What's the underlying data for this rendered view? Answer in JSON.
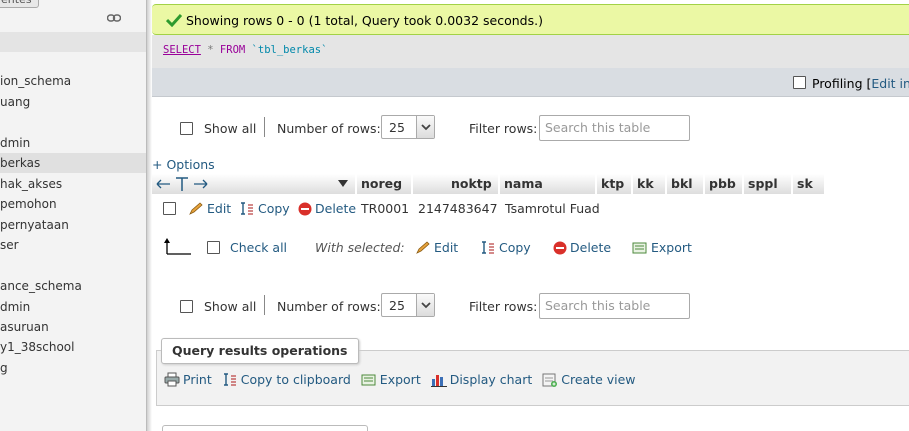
{
  "sidebar": {
    "top_tab": "entes",
    "databases": [
      {
        "label": "ion_schema"
      },
      {
        "label": "uang"
      },
      {
        "label": "dmin"
      },
      {
        "label": "berkas",
        "selected": true
      },
      {
        "label": "hak_akses"
      },
      {
        "label": "pemohon"
      },
      {
        "label": "pernyataan"
      },
      {
        "label": "ser"
      },
      {
        "label": "ance_schema"
      },
      {
        "label": "dmin"
      },
      {
        "label": "asuruan"
      },
      {
        "label": "y1_38school"
      },
      {
        "label": "g"
      }
    ]
  },
  "message": {
    "text": "Showing rows 0 - 0 (1 total, Query took 0.0032 seconds.)",
    "color": "#ebf8a4"
  },
  "sql": {
    "select": "SELECT",
    "star": "*",
    "from": "FROM",
    "table": "`tbl_berkas`"
  },
  "profiling": {
    "label": "Profiling [",
    "edit_inline": "Edit inli"
  },
  "nav": {
    "show_all": "Show all",
    "number_of_rows_label": "Number of rows:",
    "rows_value": "25",
    "filter_label": "Filter rows:",
    "filter_placeholder": "Search this table"
  },
  "options_link": "+ Options",
  "table": {
    "columns": [
      "noreg",
      "noktp",
      "nama",
      "ktp",
      "kk",
      "bkl",
      "pbb",
      "sppl",
      "sk"
    ],
    "row_actions": {
      "edit": "Edit",
      "copy": "Copy",
      "delete": "Delete"
    },
    "rows": [
      {
        "noreg": "TR0001",
        "noktp": "2147483647",
        "nama": "Tsamrotul Fuad"
      }
    ]
  },
  "bulk": {
    "check_all": "Check all",
    "with_selected": "With selected:",
    "edit": "Edit",
    "copy": "Copy",
    "delete": "Delete",
    "export": "Export"
  },
  "query_ops": {
    "title": "Query results operations",
    "print": "Print",
    "copy_clipboard": "Copy to clipboard",
    "export": "Export",
    "display_chart": "Display chart",
    "create_view": "Create view"
  },
  "colors": {
    "link": "#235a81",
    "success_bg": "#ebf8a4",
    "delete_red": "#d9302a"
  }
}
